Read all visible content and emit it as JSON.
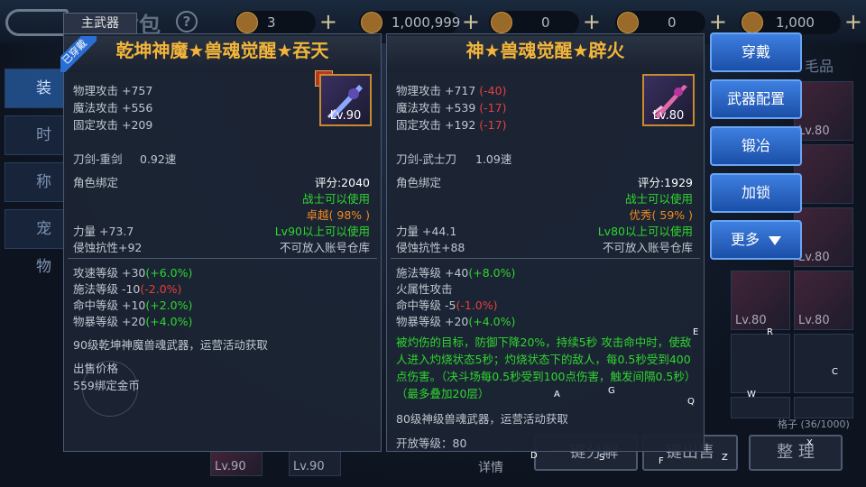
{
  "header": {
    "bag_title": "背包",
    "help": "?",
    "resources": [
      {
        "icon": "gem-icon",
        "value": "3"
      },
      {
        "icon": "gold-icon",
        "value": "1,000,999"
      },
      {
        "icon": "ticket-icon",
        "value": "0"
      },
      {
        "icon": "coin-icon",
        "value": "0"
      },
      {
        "icon": "token-icon",
        "value": "1,000"
      }
    ]
  },
  "left_tabs": [
    "装备",
    "时装",
    "称号",
    "宠物"
  ],
  "item1": {
    "slot_tag": "主武器",
    "equipped_tag": "已穿戴",
    "name": "乾坤神魔★兽魂觉醒★吞天",
    "main_badge": "主",
    "level": "Lv.90",
    "stats": [
      "物理攻击 +757",
      "魔法攻击 +556",
      "固定攻击 +209"
    ],
    "weapon_type": "刀剑-重剑",
    "speed": "0.92速",
    "bind": "角色绑定",
    "score": "评分:2040",
    "class_req": "战士可以使用",
    "quality": "卓越( 98% )",
    "strength": "力量 +73.7",
    "level_req": "Lv90以上可以使用",
    "corrosion": "侵蚀抗性+92",
    "account_storage": "不可放入账号仓库",
    "grade_lines": [
      {
        "text": "攻速等级 +30",
        "delta": "(+6.0%)",
        "tone": "green"
      },
      {
        "text": "施法等级 -10",
        "delta": "(-2.0%)",
        "tone": "red"
      },
      {
        "text": "命中等级 +10",
        "delta": "(+2.0%)",
        "tone": "green"
      },
      {
        "text": "物暴等级 +20",
        "delta": "(+4.0%)",
        "tone": "green"
      }
    ],
    "source": "90级乾坤神魔兽魂武器，运营活动获取",
    "sell_label": "出售价格",
    "sell_value": "559绑定金币"
  },
  "item2": {
    "name": "神★兽魂觉醒★辟火",
    "level": "Lv.80",
    "stats": [
      {
        "text": "物理攻击 +717",
        "delta": "(-40)"
      },
      {
        "text": "魔法攻击 +539",
        "delta": "(-17)"
      },
      {
        "text": "固定攻击 +192",
        "delta": "(-17)"
      }
    ],
    "weapon_type": "刀剑-武士刀",
    "speed": "1.09速",
    "bind": "角色绑定",
    "score": "评分:1929",
    "class_req": "战士可以使用",
    "quality": "优秀( 59% )",
    "strength": "力量 +44.1",
    "level_req": "Lv80以上可以使用",
    "corrosion": "侵蚀抗性+88",
    "account_storage": "不可放入账号仓库",
    "grade_lines": [
      {
        "text": "施法等级 +40",
        "delta": "(+8.0%)",
        "tone": "green"
      },
      {
        "text": "火属性攻击",
        "delta": "",
        "tone": "green"
      },
      {
        "text": "命中等级 -5",
        "delta": "(-1.0%)",
        "tone": "red"
      },
      {
        "text": "物暴等级 +20",
        "delta": "(+4.0%)",
        "tone": "green"
      }
    ],
    "effect": "被灼伤的目标，防御下降20%，持续5秒 攻击命中时，使敌人进入灼烧状态5秒；灼烧状态下的敌人，每0.5秒受到400点伤害。（决斗场每0.5秒受到100点伤害，触发间隔0.5秒）（最多叠加20层）",
    "source": "80级神级兽魂武器，运营活动获取",
    "open_level": "开放等级：80"
  },
  "actions": {
    "wear": "穿戴",
    "weapon_config": "武器配置",
    "forge": "锻冶",
    "lock": "加锁",
    "more": "更多"
  },
  "bag": {
    "capacity": "格子 (36/1000)",
    "sort": "整 理",
    "details": "详情",
    "sell_partial": "键出售",
    "decompose_partial": "一键分解",
    "slot_levels": [
      "Lv.80",
      "Lv.80",
      "Lv.80",
      "Lv.80",
      "Lv.90",
      "Lv.90"
    ]
  },
  "keys": [
    "E",
    "R",
    "C",
    "W",
    "Q",
    "G",
    "A",
    "D",
    "S",
    "F",
    "Z",
    "X"
  ],
  "partial_text": "毛品"
}
